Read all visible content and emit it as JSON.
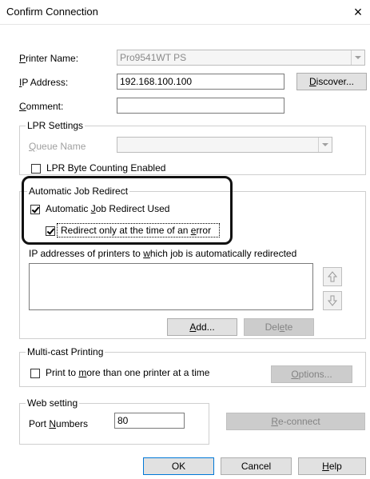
{
  "window": {
    "title": "Confirm Connection",
    "close_glyph": "×"
  },
  "printer_name": {
    "label": "Printer Name:",
    "value": "Pro9541WT PS"
  },
  "ip_address": {
    "label": "IP Address:",
    "value": "192.168.100.100",
    "discover_button": "Discover..."
  },
  "comment": {
    "label": "Comment:",
    "value": ""
  },
  "lpr": {
    "title": "LPR Settings",
    "queue_label": "Queue Name",
    "queue_value": "",
    "byte_counting": "LPR Byte Counting Enabled",
    "byte_counting_checked": false
  },
  "redirect": {
    "title": "Automatic Job Redirect",
    "used_label": "Automatic Job Redirect Used",
    "used_checked": true,
    "only_error_label": "Redirect only at the time of an error",
    "only_error_checked": true,
    "list_label": "IP addresses of printers to which job is automatically redirected",
    "add_button": "Add...",
    "delete_button": "Delete",
    "up_icon": "arrow-up-icon",
    "down_icon": "arrow-down-icon"
  },
  "multicast": {
    "title": "Multi-cast Printing",
    "checkbox_label": "Print to more than one printer at a time",
    "checked": false,
    "options_button": "Options..."
  },
  "web": {
    "title": "Web setting",
    "port_label": "Port Numbers",
    "port_value": "80",
    "reconnect_button": "Re-connect"
  },
  "footer": {
    "ok": "OK",
    "cancel": "Cancel",
    "help": "Help"
  },
  "colors": {
    "highlight_frame": "#111111",
    "default_button_border": "#0078d7",
    "disabled_text": "#a0a0a0"
  }
}
